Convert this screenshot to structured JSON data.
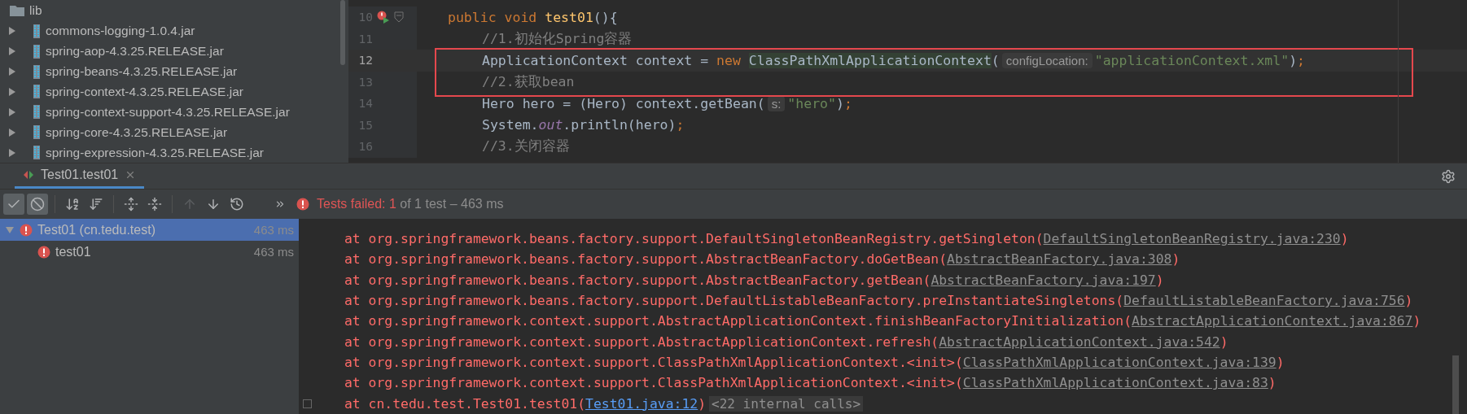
{
  "project_tree": {
    "folder": "lib",
    "items": [
      {
        "name": "commons-logging-1.0.4.jar",
        "expanded": false
      },
      {
        "name": "spring-aop-4.3.25.RELEASE.jar",
        "expanded": false
      },
      {
        "name": "spring-beans-4.3.25.RELEASE.jar",
        "expanded": false
      },
      {
        "name": "spring-context-4.3.25.RELEASE.jar",
        "expanded": false
      },
      {
        "name": "spring-context-support-4.3.25.RELEASE.jar",
        "expanded": false
      },
      {
        "name": "spring-core-4.3.25.RELEASE.jar",
        "expanded": false
      },
      {
        "name": "spring-expression-4.3.25.RELEASE.jar",
        "expanded": false
      }
    ]
  },
  "editor": {
    "lines": [
      {
        "number": "10",
        "current": false,
        "boxed": false,
        "run_marker": true,
        "tokens": [
          {
            "kind": "keyword",
            "text": "public void "
          },
          {
            "kind": "method",
            "text": "test01"
          },
          {
            "kind": "plain",
            "text": "(){"
          }
        ]
      },
      {
        "number": "11",
        "current": false,
        "boxed": false,
        "run_marker": false,
        "tokens": [
          {
            "kind": "comment",
            "text": "//1.初始化Spring容器"
          }
        ]
      },
      {
        "number": "12",
        "current": true,
        "boxed": true,
        "run_marker": false,
        "tokens": [
          {
            "kind": "plain",
            "text": "ApplicationContext context = "
          },
          {
            "kind": "keyword",
            "text": "new "
          },
          {
            "kind": "class",
            "text": "ClassPathXmlApplicationContext"
          },
          {
            "kind": "plain",
            "text": "("
          },
          {
            "kind": "hint",
            "text": "configLocation:"
          },
          {
            "kind": "string",
            "text": "\"applicationContext.xml\""
          },
          {
            "kind": "plain",
            "text": ")"
          },
          {
            "kind": "keyword",
            "text": ";"
          }
        ]
      },
      {
        "number": "13",
        "current": false,
        "boxed": true,
        "run_marker": false,
        "tokens": [
          {
            "kind": "comment",
            "text": "//2.获取bean"
          }
        ]
      },
      {
        "number": "14",
        "current": false,
        "boxed": false,
        "run_marker": false,
        "tokens": [
          {
            "kind": "plain",
            "text": "Hero hero = (Hero) context.getBean("
          },
          {
            "kind": "hint",
            "text": "s:"
          },
          {
            "kind": "string",
            "text": "\"hero\""
          },
          {
            "kind": "plain",
            "text": ")"
          },
          {
            "kind": "keyword",
            "text": ";"
          }
        ]
      },
      {
        "number": "15",
        "current": false,
        "boxed": false,
        "run_marker": false,
        "tokens": [
          {
            "kind": "plain",
            "text": "System."
          },
          {
            "kind": "field",
            "text": "out"
          },
          {
            "kind": "plain",
            "text": ".println(hero)"
          },
          {
            "kind": "keyword",
            "text": ";"
          }
        ]
      },
      {
        "number": "16",
        "current": false,
        "boxed": false,
        "run_marker": false,
        "tokens": [
          {
            "kind": "comment",
            "text": "//3.关闭容器"
          }
        ]
      }
    ]
  },
  "run_tabs": [
    {
      "label": "Test01.test01",
      "selected": true
    }
  ],
  "toolbar": [
    [
      {
        "kind": "check",
        "on": true,
        "disabled": false
      },
      {
        "kind": "ignore",
        "on": true,
        "disabled": false
      }
    ],
    [
      {
        "kind": "sort-alpha",
        "on": false,
        "disabled": false
      },
      {
        "kind": "sort-duration",
        "on": false,
        "disabled": false
      }
    ],
    [
      {
        "kind": "expand",
        "on": false,
        "disabled": false
      },
      {
        "kind": "collapse",
        "on": false,
        "disabled": false
      }
    ],
    [
      {
        "kind": "up",
        "on": false,
        "disabled": true
      },
      {
        "kind": "down",
        "on": false,
        "disabled": false
      },
      {
        "kind": "history",
        "on": false,
        "disabled": false
      }
    ]
  ],
  "status": {
    "failed_label": "Tests failed:",
    "failed_count": "1",
    "summary": "of 1 test – 463 ms"
  },
  "test_tree": [
    {
      "label": "Test01 (cn.tedu.test)",
      "time": "463 ms",
      "selected": true,
      "expanded": true,
      "children": [
        {
          "label": "test01",
          "time": "463 ms",
          "selected": false
        }
      ]
    }
  ],
  "console": [
    {
      "kind": "external",
      "text": "at org.springframework.beans.factory.support.DefaultSingletonBeanRegistry.getSingleton(",
      "link": "DefaultSingletonBeanRegistry.java:230",
      "after": ")"
    },
    {
      "kind": "external",
      "text": "at org.springframework.beans.factory.support.AbstractBeanFactory.doGetBean(",
      "link": "AbstractBeanFactory.java:308",
      "after": ")"
    },
    {
      "kind": "external",
      "text": "at org.springframework.beans.factory.support.AbstractBeanFactory.getBean(",
      "link": "AbstractBeanFactory.java:197",
      "after": ")"
    },
    {
      "kind": "external",
      "text": "at org.springframework.beans.factory.support.DefaultListableBeanFactory.preInstantiateSingletons(",
      "link": "DefaultListableBeanFactory.java:756",
      "after": ")"
    },
    {
      "kind": "external",
      "text": "at org.springframework.context.support.AbstractApplicationContext.finishBeanFactoryInitialization(",
      "link": "AbstractApplicationContext.java:867",
      "after": ")"
    },
    {
      "kind": "external",
      "text": "at org.springframework.context.support.AbstractApplicationContext.refresh(",
      "link": "AbstractApplicationContext.java:542",
      "after": ")"
    },
    {
      "kind": "external",
      "text": "at org.springframework.context.support.ClassPathXmlApplicationContext.<init>(",
      "link": "ClassPathXmlApplicationContext.java:139",
      "after": ")"
    },
    {
      "kind": "external",
      "text": "at org.springframework.context.support.ClassPathXmlApplicationContext.<init>(",
      "link": "ClassPathXmlApplicationContext.java:83",
      "after": ")"
    },
    {
      "kind": "source",
      "text": "at cn.tedu.test.Test01.test01(",
      "link": "Test01.java:12",
      "after": ")",
      "note": "<22 internal calls>"
    }
  ]
}
